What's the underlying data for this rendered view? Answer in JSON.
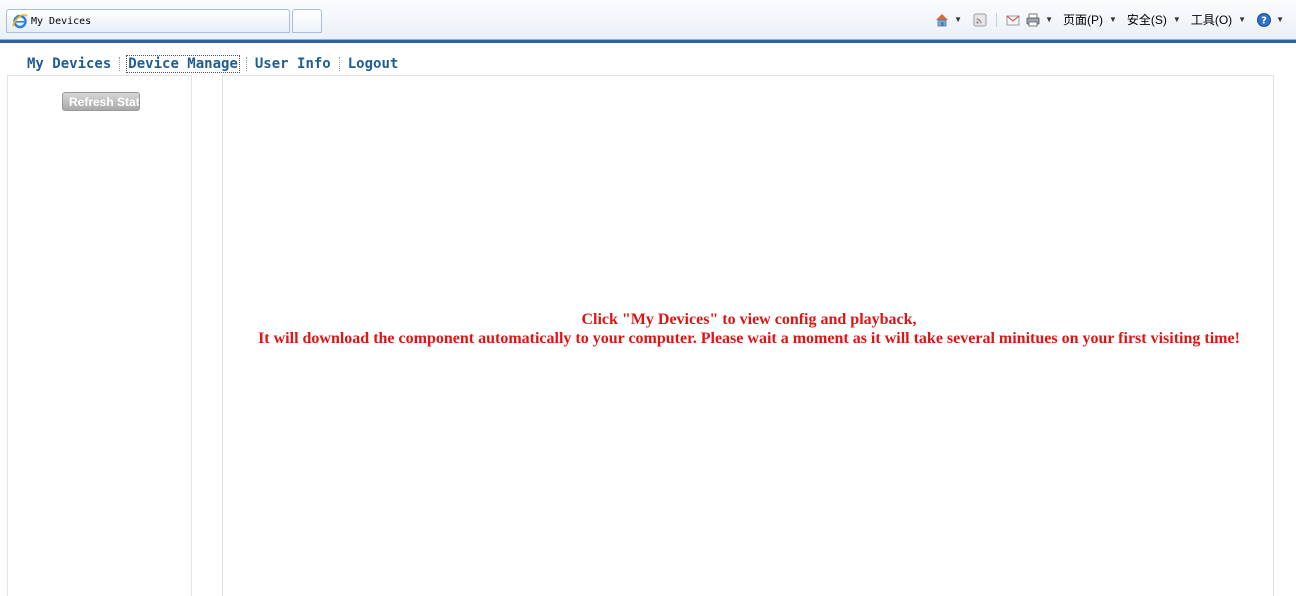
{
  "browser": {
    "tab_title": "My Devices",
    "icons": [
      "ie-logo-icon",
      "home-icon",
      "feed-icon",
      "mail-icon",
      "print-icon",
      "help-icon"
    ],
    "menus": {
      "page": "页面(P)",
      "safety": "安全(S)",
      "tools": "工具(O)"
    },
    "accent": "#2f5ea8"
  },
  "nav": {
    "items": [
      {
        "label": "My Devices"
      },
      {
        "label": "Device Manage"
      },
      {
        "label": "User Info"
      },
      {
        "label": "Logout"
      }
    ],
    "active_index": 1,
    "color": "#1f5d94"
  },
  "sidebar": {
    "refresh_label": "Refresh Stat"
  },
  "main": {
    "message_line1": "Click \"My Devices\" to view config and playback,",
    "message_line2": "It will download the component automatically to your computer. Please wait a moment as it will take several minitues on your first visiting time!",
    "message_color": "#e01414"
  }
}
